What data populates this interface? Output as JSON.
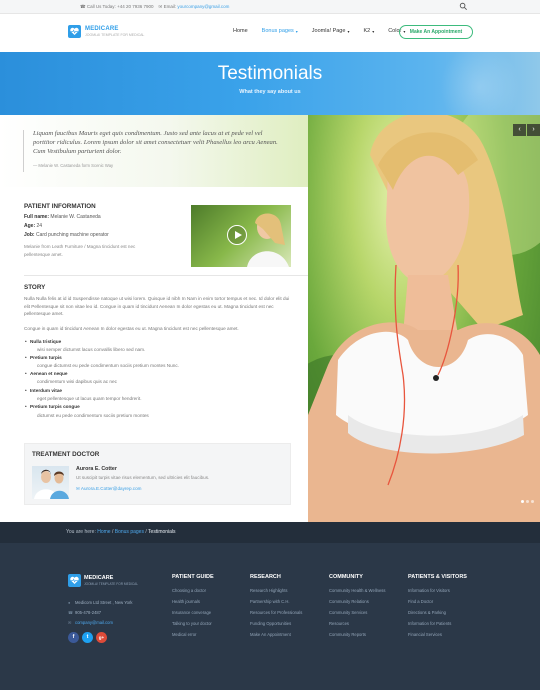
{
  "topbar": {
    "phone_label": "Call Us Today:",
    "phone": "+44 20 7936 7900",
    "email_label": "Email:",
    "email": "yourcompany@gmail.com"
  },
  "brand": {
    "name": "MEDICARE",
    "tagline": "JOOMLA! TEMPLATE FOR MEDICAL"
  },
  "nav": {
    "items": [
      {
        "label": "Home",
        "caret": ""
      },
      {
        "label": "Bonus pages",
        "caret": "▾"
      },
      {
        "label": "Joomla! Page",
        "caret": "▾"
      },
      {
        "label": "K2",
        "caret": "▾"
      },
      {
        "label": "Color",
        "caret": "▾"
      }
    ],
    "cta": "Make An Appointment"
  },
  "hero": {
    "title": "Testimonials",
    "subtitle": "What they say about us"
  },
  "quote": {
    "text": "Liquam faucibus Mauris eget quis condimentum. Justo sed ante lacus at et pede vel vel porttitor ridiculus. Lorem ipsum dolor sit amet consectetuer velit Phasellus leo arcu Aenean. Cum Vestibulum parturient dolor.",
    "cite": "— Melanie W. Castaneda form Scenic Way"
  },
  "patient": {
    "heading": "PATIENT INFORMATION",
    "full_name_label": "Full name:",
    "full_name": "Melanie W. Castaneda",
    "age_label": "Age:",
    "age": "24",
    "job_label": "Job:",
    "job": "Card punching machine operator",
    "desc_1": "Melanie from Leath Furniture / Magna tincidunt est nec",
    "desc_2": "pellentesque amet."
  },
  "story": {
    "heading": "STORY",
    "para1": "Nulla Nulla felis at id id Suspendisse natoque ut wisi lorem. Quisque id nibh In Nam in enim tortor tempus et nec. Id dolor elit dui elit Pellentesque sit non vitae leo id. Congue in quam id tincidunt Aenean In dolor egestas eu ut. Magna tincidunt est nec pellentesque amet.",
    "para2": "Congue in quam id tincidunt Aenean In dolor egestas eu ut. Magna tincidunt est nec pellentesque amet.",
    "bullets": [
      {
        "title": "Nulla tristique",
        "text": "wisi semper dictumst lacus convallis libero sed nam."
      },
      {
        "title": "Pretium turpis",
        "text": "congue dictumst eu pede condimentum sociis pretium montes Nunc."
      },
      {
        "title": "Aenean et neque",
        "text": "condimentum wisi dapibus quis ac nec"
      },
      {
        "title": "Interdum vitae",
        "text": "eget pellentesque ut lacus quam tempor hendrerit."
      },
      {
        "title": "Pretium turpis congue",
        "text": "dictumst eu pede condimentum sociis pretium montes"
      }
    ]
  },
  "doctor": {
    "heading": "TREATMENT DOCTOR",
    "name": "Aurora E. Cotter",
    "text": "Ut suscipit turpis vitae risus elementum, sed ultricies elit faucibus.",
    "email": "Aurora.E.Cotter@dayrep.com"
  },
  "breadcrumb": {
    "prefix": "You are here:",
    "home": "Home",
    "sep": "/",
    "parent": "Bonus pages",
    "current": "Testimonials"
  },
  "footer": {
    "address": "Medicom Ltd Street , New York",
    "phone": "905-478-2487",
    "email": "company@mail.com",
    "socials": [
      {
        "name": "facebook",
        "glyph": "f",
        "color": "#3b5998"
      },
      {
        "name": "twitter",
        "glyph": "t",
        "color": "#1da1f2"
      },
      {
        "name": "google-plus",
        "glyph": "g+",
        "color": "#dd4b39"
      }
    ],
    "columns": [
      {
        "title": "PATIENT GUIDE",
        "items": [
          "Choosing a doctor",
          "Health journals",
          "Insurance converage",
          "Talking to your doctor",
          "Medical error"
        ]
      },
      {
        "title": "RESEARCH",
        "items": [
          "Research Highlights",
          "Partnership with C.H.",
          "Resources for Professionals",
          "Funding Opportunities",
          "Make An Appointment"
        ]
      },
      {
        "title": "COMMUNITY",
        "items": [
          "Community Health & Wellness",
          "Community Relations",
          "Community Services",
          "Resources",
          "Community Reports"
        ]
      },
      {
        "title": "PATIENTS & VISITORS",
        "items": [
          "Information for Visitors",
          "Find a Doctor",
          "Directions & Parking",
          "Information for Patients",
          "Financial Services"
        ]
      }
    ]
  },
  "colors": {
    "brand_blue": "#2f9ee8",
    "cta_green": "#3dbb7d",
    "footer_bg": "#2b3848",
    "breadcrumb_bg": "#232e3b"
  }
}
